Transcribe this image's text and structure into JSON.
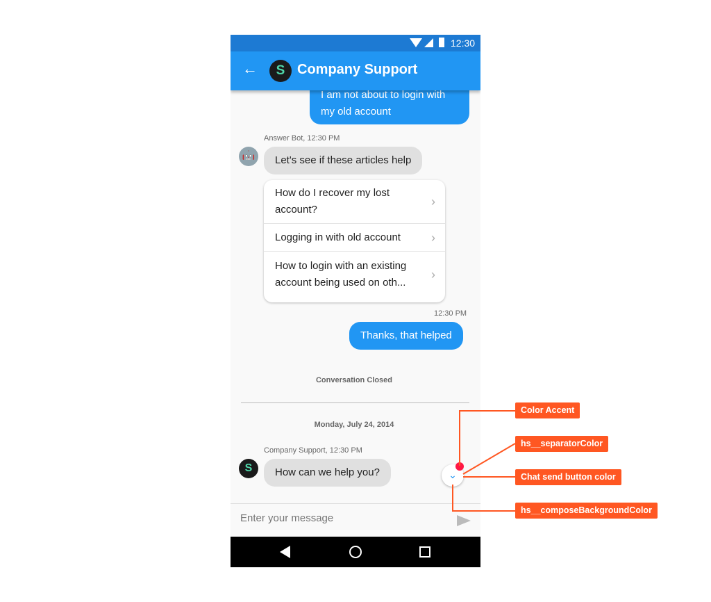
{
  "status_bar": {
    "time": "12:30"
  },
  "header": {
    "title": "Company Support",
    "avatar_letter": "S"
  },
  "messages": {
    "user_1": "I am not about to login with my old account",
    "bot_meta": "Answer Bot, 12:30 PM",
    "bot_text": "Let's see if these articles help",
    "articles": [
      "How do I recover my lost account?",
      "Logging in with old account",
      "How to login with an existing account being used on oth..."
    ],
    "user_2_meta": "12:30 PM",
    "user_2": "Thanks, that helped",
    "closed": "Conversation Closed",
    "date": "Monday, July 24, 2014",
    "agent_meta": "Company Support, 12:30 PM",
    "agent_text": "How can we help you?"
  },
  "compose": {
    "placeholder": "Enter your message"
  },
  "annotations": [
    "Color Accent",
    "hs__separatorColor",
    "Chat send button color",
    "hs__composeBackgroundColor"
  ],
  "colors": {
    "primary": "#2196f3",
    "accent": "#ff1744",
    "annotation": "#ff5722"
  }
}
